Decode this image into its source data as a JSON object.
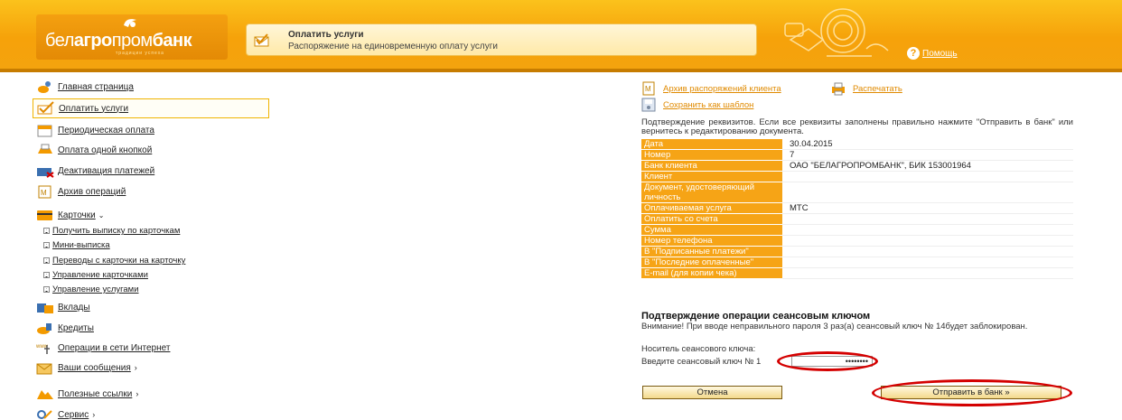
{
  "header": {
    "logo_prefix": "бел",
    "logo_mid": "агро",
    "logo_bold": "пром",
    "logo_suffix": "банк",
    "logo_slogan": "традиции успеха",
    "title": "Оплатить услуги",
    "subtitle": "Распоряжение на единовременную оплату услуги",
    "help_label": "Помощь"
  },
  "sidebar": {
    "items": [
      {
        "label": "Главная страница",
        "icon": "home-icon"
      },
      {
        "label": "Оплатить услуги",
        "icon": "pay-icon"
      },
      {
        "label": "Периодическая оплата",
        "icon": "calendar-icon"
      },
      {
        "label": "Оплата одной кнопкой",
        "icon": "one-button-icon"
      },
      {
        "label": "Деактивация платежей",
        "icon": "deactivate-icon"
      },
      {
        "label": "Архив операций",
        "icon": "archive-icon"
      },
      {
        "label": "Карточки",
        "icon": "card-icon"
      },
      {
        "label": "Вклады",
        "icon": "deposit-icon"
      },
      {
        "label": "Кредиты",
        "icon": "credit-icon"
      },
      {
        "label": "Операции в сети Интернет",
        "icon": "internet-icon"
      },
      {
        "label": "Ваши сообщения",
        "icon": "messages-icon"
      },
      {
        "label": "Полезные ссылки",
        "icon": "links-icon"
      },
      {
        "label": "Сервис",
        "icon": "service-icon"
      }
    ],
    "card_sub_items": [
      "Получить выписку по карточкам",
      "Мини-выписка",
      "Переводы с карточки на карточку",
      "Управление карточками",
      "Управление услугами"
    ]
  },
  "main": {
    "links": {
      "archive": "Архив распоряжений клиента",
      "print": "Распечатать",
      "save_template": "Сохранить как шаблон"
    },
    "confirm_text": "Подтверждение реквизитов. Если все реквизиты заполнены правильно нажмите \"Отправить в банк\" или вернитесь к редактированию документа.",
    "requisites": [
      {
        "key": "Дата",
        "value": "30.04.2015"
      },
      {
        "key": "Номер",
        "value": "7"
      },
      {
        "key": "Банк клиента",
        "value": "ОАО \"БЕЛАГРОПРОМБАНК\", БИК 153001964"
      },
      {
        "key": "Клиент",
        "value": ""
      },
      {
        "key": "Документ, удостоверяющий личность",
        "value": ""
      },
      {
        "key": "Оплачиваемая услуга",
        "value": "МТС"
      },
      {
        "key": "Оплатить со счета",
        "value": ""
      },
      {
        "key": "Сумма",
        "value": ""
      },
      {
        "key": "Номер телефона",
        "value": ""
      },
      {
        "key": "В \"Подписанные платежи\"",
        "value": ""
      },
      {
        "key": "В \"Последние оплаченные\"",
        "value": ""
      },
      {
        "key": "E-mail (для копии чека)",
        "value": ""
      }
    ],
    "key_section": {
      "title": "Подтверждение операции сеансовым ключом",
      "warning": "Внимание! При вводе неправильного пароля 3 раз(а) сеансовый ключ № 14будет заблокирован.",
      "carrier_label": "Носитель сеансового ключа:",
      "input_label": "Введите сеансовый ключ № 1",
      "input_value": "••••••••"
    },
    "buttons": {
      "cancel": "Отмена",
      "send": "Отправить в банк »"
    }
  },
  "colors": {
    "accent": "#f6a416",
    "link": "#e08a00",
    "highlight": "#d40000"
  }
}
